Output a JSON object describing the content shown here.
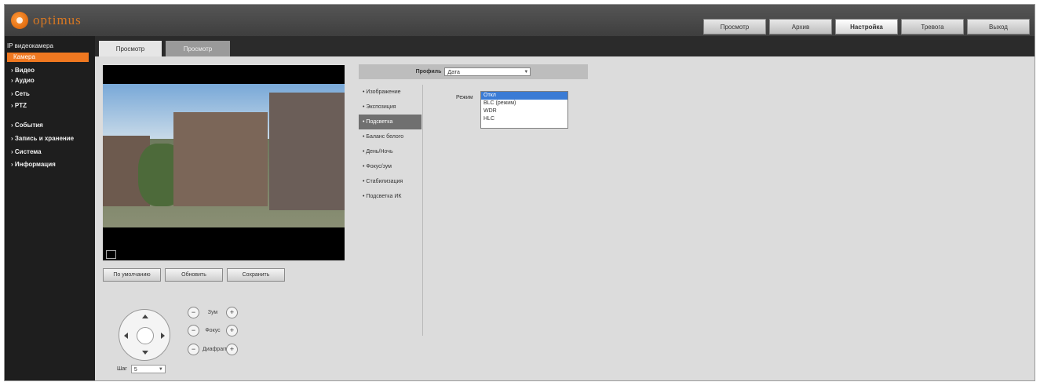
{
  "app": {
    "logo_text": "optimus",
    "brand_color": "#f07820"
  },
  "topnav": {
    "tabs": [
      {
        "label": "Просмотр",
        "active": false
      },
      {
        "label": "Архив",
        "active": false
      },
      {
        "label": "Настройка",
        "active": true
      },
      {
        "label": "Тревога",
        "active": false
      },
      {
        "label": "Выход",
        "active": false
      }
    ]
  },
  "subtabs": {
    "tab1": "Просмотр",
    "tab2": "Просмотр"
  },
  "sidebar": {
    "root": "IP видеокамера",
    "active": "Камера",
    "items": [
      "Видео",
      "Аудио",
      "Сеть",
      "PTZ",
      "События",
      "Запись и хранение",
      "Система",
      "Информация"
    ]
  },
  "video": {
    "icon": "fullscreen-icon"
  },
  "buttons": {
    "b1": "По умолчанию",
    "b2": "Обновить",
    "b3": "Сохранить"
  },
  "ptz": {
    "zoom_label": "Зум",
    "focus_label": "Фокус",
    "iris_label": "Диафрагма",
    "minus": "−",
    "plus": "+",
    "speed_label": "Шаг",
    "speed_value": "5"
  },
  "settings": {
    "profile_label": "Профиль",
    "profile_value": "Дата",
    "menu": [
      "Изображение",
      "Экспозиция",
      "Подсветка",
      "Баланс белого",
      "День/Ночь",
      "Фокус/зум",
      "Стабилизация",
      "Подсветка ИК"
    ],
    "selected_index": 2,
    "mode_label": "Режим",
    "dropdown_options": [
      "Откл",
      "BLC (режим)",
      "WDR",
      "HLC"
    ],
    "dropdown_highlight": 0
  }
}
